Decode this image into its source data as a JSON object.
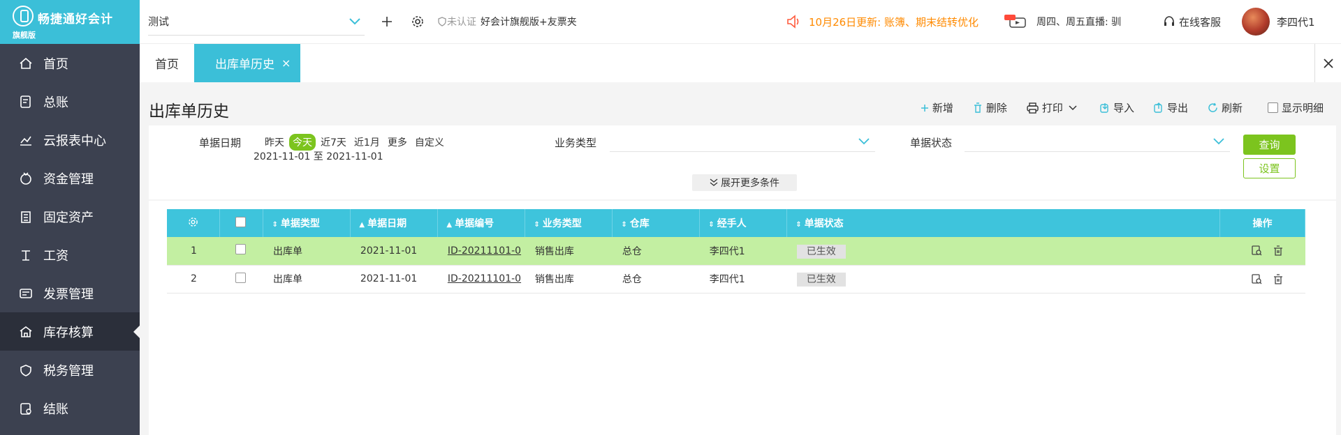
{
  "brand": {
    "name": "畅捷通好会计",
    "edition": "旗舰版"
  },
  "sidebar": {
    "items": [
      {
        "label": "首页",
        "icon": "home-icon"
      },
      {
        "label": "总账",
        "icon": "ledger-icon"
      },
      {
        "label": "云报表中心",
        "icon": "chart-icon"
      },
      {
        "label": "资金管理",
        "icon": "money-icon"
      },
      {
        "label": "固定资产",
        "icon": "asset-icon"
      },
      {
        "label": "工资",
        "icon": "salary-icon"
      },
      {
        "label": "发票管理",
        "icon": "invoice-icon"
      },
      {
        "label": "库存核算",
        "icon": "warehouse-icon",
        "active": true
      },
      {
        "label": "税务管理",
        "icon": "tax-icon"
      },
      {
        "label": "结账",
        "icon": "close-books-icon"
      }
    ]
  },
  "topbar": {
    "account": "测试",
    "auth_tag": "未认证",
    "product": "好会计旗舰版+友票夹",
    "update": "10月26日更新: 账簿、期末结转优化",
    "live": "周四、周五直播: 驯",
    "service": "在线客服",
    "user": "李四代1"
  },
  "tabs": {
    "home": "首页",
    "current": "出库单历史",
    "close": "×"
  },
  "page": {
    "title": "出库单历史",
    "toolbar": {
      "add": "新增",
      "delete": "删除",
      "print": "打印",
      "import": "导入",
      "export": "导出",
      "refresh": "刷新",
      "show_detail": "显示明细"
    }
  },
  "filters": {
    "date_label": "单据日期",
    "quick": [
      "昨天",
      "今天",
      "近7天",
      "近1月",
      "更多",
      "自定义"
    ],
    "quick_selected": "今天",
    "date_range": "2021-11-01 至 2021-11-01",
    "biz_type_label": "业务类型",
    "biz_type_value": "",
    "status_label": "单据状态",
    "status_value": "",
    "query": "查询",
    "setting": "设置",
    "expand": "展开更多条件"
  },
  "table": {
    "headers": [
      "单据类型",
      "单据日期",
      "单据编号",
      "业务类型",
      "仓库",
      "经手人",
      "单据状态",
      "操作"
    ],
    "rows": [
      {
        "no": "1",
        "type": "出库单",
        "date": "2021-11-01",
        "doc_no": "ID-20211101-0",
        "biz": "销售出库",
        "warehouse": "总仓",
        "handler": "李四代1",
        "status": "已生效"
      },
      {
        "no": "2",
        "type": "出库单",
        "date": "2021-11-01",
        "doc_no": "ID-20211101-0",
        "biz": "销售出库",
        "warehouse": "总仓",
        "handler": "李四代1",
        "status": "已生效"
      }
    ]
  },
  "colors": {
    "brand": "#3bbfd8",
    "sidebar": "#3c4150",
    "accent_green": "#7cc41e",
    "row_selected": "#c3efa2",
    "update_orange": "#ff8a00"
  }
}
